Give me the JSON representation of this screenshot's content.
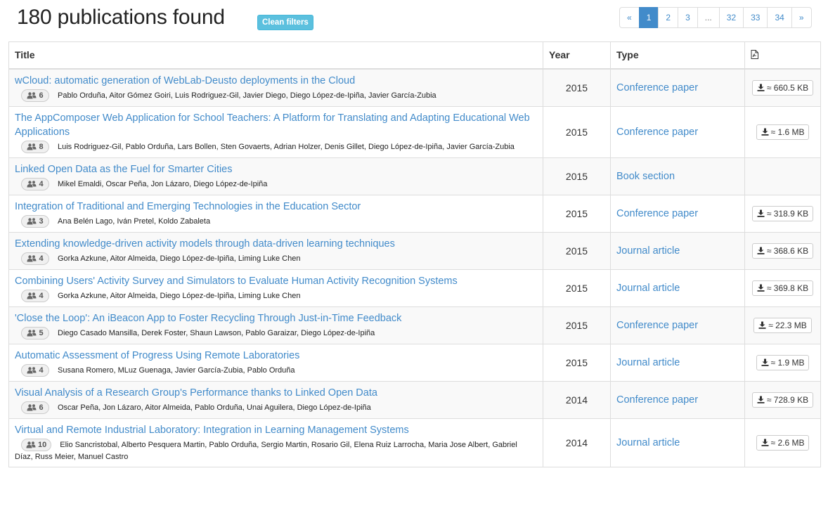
{
  "header": {
    "title": "180 publications found",
    "clean_filters": "Clean filters"
  },
  "pagination": [
    "«",
    "1",
    "2",
    "3",
    "...",
    "32",
    "33",
    "34",
    "»"
  ],
  "pagination_active": "1",
  "table": {
    "columns": {
      "title": "Title",
      "year": "Year",
      "type": "Type",
      "pdf_icon": "pdf-file-icon"
    },
    "rows": [
      {
        "title": "wCloud: automatic generation of WebLab-Deusto deployments in the Cloud",
        "author_count": "6",
        "authors": "Pablo Orduña, Aitor Gómez Goiri, Luis Rodriguez-Gil, Javier Diego, Diego López-de-Ipiña, Javier García-Zubia",
        "year": "2015",
        "type": "Conference paper",
        "download": "≈ 660.5 KB"
      },
      {
        "title": "The AppComposer Web Application for School Teachers: A Platform for Translating and Adapting Educational Web Applications",
        "author_count": "8",
        "authors": "Luis Rodriguez-Gil, Pablo Orduña, Lars Bollen, Sten Govaerts, Adrian Holzer, Denis Gillet, Diego López-de-Ipiña, Javier García-Zubia",
        "year": "2015",
        "type": "Conference paper",
        "download": "≈ 1.6 MB"
      },
      {
        "title": "Linked Open Data as the Fuel for Smarter Cities",
        "author_count": "4",
        "authors": "Mikel Emaldi, Oscar Peña, Jon Lázaro, Diego López-de-Ipiña",
        "year": "2015",
        "type": "Book section",
        "download": ""
      },
      {
        "title": "Integration of Traditional and Emerging Technologies in the Education Sector",
        "author_count": "3",
        "authors": "Ana Belén Lago, Iván Pretel, Koldo Zabaleta",
        "year": "2015",
        "type": "Conference paper",
        "download": "≈ 318.9 KB"
      },
      {
        "title": "Extending knowledge-driven activity models through data-driven learning techniques",
        "author_count": "4",
        "authors": "Gorka Azkune, Aitor Almeida, Diego López-de-Ipiña, Liming Luke Chen",
        "year": "2015",
        "type": "Journal article",
        "download": "≈ 368.6 KB"
      },
      {
        "title": "Combining Users' Activity Survey and Simulators to Evaluate Human Activity Recognition Systems",
        "author_count": "4",
        "authors": "Gorka Azkune, Aitor Almeida, Diego López-de-Ipiña, Liming Luke Chen",
        "year": "2015",
        "type": "Journal article",
        "download": "≈ 369.8 KB"
      },
      {
        "title": "'Close the Loop': An iBeacon App to Foster Recycling Through Just-in-Time Feedback",
        "author_count": "5",
        "authors": "Diego Casado Mansilla, Derek Foster, Shaun Lawson, Pablo Garaizar, Diego López-de-Ipiña",
        "year": "2015",
        "type": "Conference paper",
        "download": "≈ 22.3 MB"
      },
      {
        "title": "Automatic Assessment of Progress Using Remote Laboratories",
        "author_count": "4",
        "authors": "Susana Romero, MLuz Guenaga, Javier García-Zubia, Pablo Orduña",
        "year": "2015",
        "type": "Journal article",
        "download": "≈ 1.9 MB"
      },
      {
        "title": "Visual Analysis of a Research Group's Performance thanks to Linked Open Data",
        "author_count": "6",
        "authors": "Oscar Peña, Jon Lázaro, Aitor Almeida, Pablo Orduña, Unai Aguilera, Diego López-de-Ipiña",
        "year": "2014",
        "type": "Conference paper",
        "download": "≈ 728.9 KB"
      },
      {
        "title": "Virtual and Remote Industrial Laboratory: Integration in Learning Management Systems",
        "author_count": "10",
        "authors": "Elio Sancristobal, Alberto Pesquera Martin, Pablo Orduña, Sergio Martin, Rosario Gil, Elena Ruiz Larrocha, Maria Jose Albert, Gabriel Díaz, Russ Meier, Manuel Castro",
        "year": "2014",
        "type": "Journal article",
        "download": "≈ 2.6 MB"
      }
    ]
  },
  "icons": {
    "authors": "group-users-icon",
    "download": "download-icon"
  },
  "colors": {
    "link": "#428bca",
    "info_button": "#5bc0de",
    "active_page": "#428bca"
  }
}
